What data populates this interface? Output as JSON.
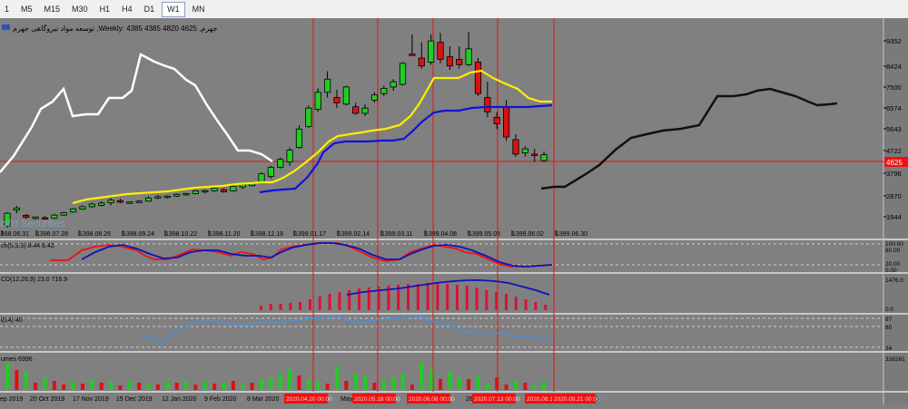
{
  "toolbar": {
    "timeframes": [
      {
        "label": "1",
        "active": false
      },
      {
        "label": "M5",
        "active": false
      },
      {
        "label": "M15",
        "active": false
      },
      {
        "label": "M30",
        "active": false
      },
      {
        "label": "H1",
        "active": false
      },
      {
        "label": "H4",
        "active": false
      },
      {
        "label": "D1",
        "active": false
      },
      {
        "label": "W1",
        "active": true
      },
      {
        "label": "MN",
        "active": false
      }
    ]
  },
  "chart": {
    "header": "توسعه مواد نیروگاهی جهرم ,Weekly: 4385 4385 4820 4625 ,جهرم",
    "watermark": "lofid Securities",
    "colors": {
      "background": "#808080",
      "bull": "#22cc22",
      "bear": "#dd1111",
      "tenkan": "#ffee00",
      "kijun": "#1111dd",
      "chikou": "#ffffff",
      "chikou2": "#000000",
      "vline": "#ee1111",
      "hline": "#ee1111"
    },
    "price_scale": [
      "9352",
      "8424",
      "7500",
      "6574",
      "5643",
      "4722",
      "3796",
      "2870",
      "1944"
    ],
    "current_price": "4625",
    "date_labels": [
      "1398.06.31",
      "1398.07.28",
      "1398.08.26",
      "1398.09.24",
      "1398.10.22",
      "1398.11.20",
      "1398.12.18",
      "1399.01.17",
      "1399.02.14",
      "1399.03.11",
      "1399.04.08",
      "1399.05.05",
      "1399.06.02",
      "1399.06.30"
    ]
  },
  "indicators": {
    "stochastic": {
      "label": "ch(5,3,3) 8.44 8.42",
      "scale": [
        "100.00",
        "80.00",
        "20.00",
        "0.00"
      ]
    },
    "macd": {
      "label": "CD(12,26,9) 23.0 716.9",
      "scale": [
        "1476.0",
        "0.0"
      ]
    },
    "rsi": {
      "label": "l(14) 40",
      "scale": [
        "97",
        "80",
        "34"
      ]
    },
    "volumes": {
      "label": "umes 6996",
      "scale": [
        "338281"
      ]
    }
  },
  "timeline": {
    "labels": [
      "ep 2019",
      "20 Oct 2019",
      "17 Nov 2019",
      "15 Dec 2019",
      "12 Jan 2020",
      "9 Feb 2020",
      "8 Mar 2020",
      "May",
      "26",
      "20"
    ],
    "red_tags": [
      "2020.04.20 00:00",
      "2020.05.18 00:00",
      "2020.06.08 00:00",
      "2020.07.13 00:00",
      "2020.08.10 00:00",
      "2020.09.21 00:00"
    ]
  },
  "chart_data": {
    "type": "candlestick",
    "timeframe": "Weekly",
    "ohlc": [
      [
        1900,
        2450,
        1850,
        2400
      ],
      [
        2520,
        2680,
        2400,
        2600
      ],
      [
        2320,
        2380,
        2180,
        2250
      ],
      [
        2200,
        2280,
        2150,
        2260
      ],
      [
        2230,
        2310,
        2160,
        2190
      ],
      [
        2220,
        2380,
        2180,
        2330
      ],
      [
        2330,
        2450,
        2300,
        2420
      ],
      [
        2450,
        2600,
        2420,
        2570
      ],
      [
        2560,
        2700,
        2530,
        2650
      ],
      [
        2650,
        2800,
        2600,
        2750
      ],
      [
        2700,
        2850,
        2660,
        2790
      ],
      [
        2800,
        2980,
        2700,
        2900
      ],
      [
        2880,
        2960,
        2780,
        2820
      ],
      [
        2800,
        2850,
        2760,
        2830
      ],
      [
        2830,
        2900,
        2790,
        2860
      ],
      [
        2860,
        3050,
        2830,
        2980
      ],
      [
        2980,
        3100,
        2940,
        3030
      ],
      [
        3020,
        3080,
        2960,
        3050
      ],
      [
        3050,
        3150,
        3020,
        3120
      ],
      [
        3100,
        3180,
        3060,
        3150
      ],
      [
        3150,
        3280,
        3120,
        3250
      ],
      [
        3230,
        3300,
        3150,
        3260
      ],
      [
        3250,
        3380,
        3220,
        3350
      ],
      [
        3300,
        3350,
        3180,
        3220
      ],
      [
        3250,
        3450,
        3220,
        3420
      ],
      [
        3400,
        3560,
        3330,
        3500
      ],
      [
        3450,
        3600,
        3420,
        3550
      ],
      [
        3600,
        3950,
        3540,
        3900
      ],
      [
        3800,
        4200,
        3720,
        4150
      ],
      [
        4150,
        4520,
        4100,
        4450
      ],
      [
        4350,
        4900,
        4200,
        4800
      ],
      [
        4900,
        5750,
        4850,
        5600
      ],
      [
        5700,
        6500,
        5650,
        6400
      ],
      [
        6350,
        7150,
        6250,
        7000
      ],
      [
        7000,
        7800,
        6800,
        7500
      ],
      [
        6800,
        7100,
        6400,
        6600
      ],
      [
        6550,
        7250,
        6500,
        7200
      ],
      [
        6450,
        6600,
        6150,
        6200
      ],
      [
        6200,
        6550,
        6100,
        6400
      ],
      [
        6700,
        7000,
        6600,
        6900
      ],
      [
        6950,
        7250,
        6850,
        7150
      ],
      [
        7200,
        7500,
        7050,
        7400
      ],
      [
        7300,
        8150,
        7250,
        8100
      ],
      [
        8450,
        9200,
        8400,
        8400
      ],
      [
        8300,
        8900,
        7900,
        8000
      ],
      [
        8150,
        9200,
        8050,
        8950
      ],
      [
        8900,
        9250,
        8100,
        8250
      ],
      [
        8350,
        8750,
        7850,
        8000
      ],
      [
        8250,
        8750,
        7900,
        8050
      ],
      [
        8050,
        9300,
        8000,
        8650
      ],
      [
        8150,
        8300,
        6850,
        6950
      ],
      [
        6800,
        7400,
        6050,
        6250
      ],
      [
        6050,
        6250,
        5600,
        5800
      ],
      [
        6450,
        6700,
        5150,
        5300
      ],
      [
        5200,
        5400,
        4550,
        4650
      ],
      [
        4700,
        4950,
        4550,
        4850
      ],
      [
        4650,
        4850,
        4350,
        4600
      ],
      [
        4400,
        4750,
        4350,
        4625
      ]
    ],
    "price_range": [
      1750,
      9750
    ],
    "indicator_values": {
      "stochastic": [
        8.44,
        8.42
      ],
      "macd": [
        23.0,
        716.9
      ],
      "rsi": 40,
      "volume": 6996
    }
  }
}
